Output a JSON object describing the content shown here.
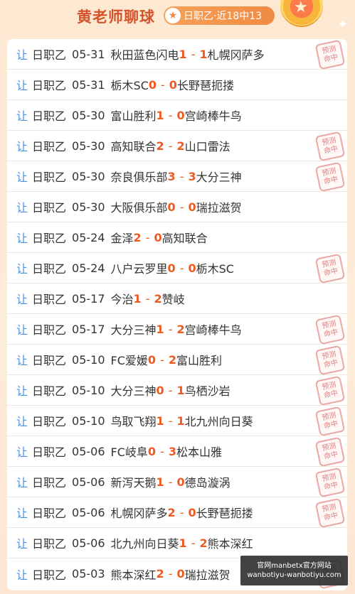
{
  "header": {
    "title": "黄老师聊球",
    "tag": "日职乙·近18中13",
    "tag_icon": "star-icon"
  },
  "stamp_text": [
    "预测",
    "命中"
  ],
  "matches": [
    {
      "rang": "让",
      "league": "日职乙",
      "date": "05-31",
      "home": "秋田蓝色闪电",
      "hs": "1",
      "as": "1",
      "away": "札幌冈萨多",
      "hit": true
    },
    {
      "rang": "让",
      "league": "日职乙",
      "date": "05-31",
      "home": "栃木SC",
      "hs": "0",
      "as": "0",
      "away": "长野琶扼搂",
      "hit": false
    },
    {
      "rang": "让",
      "league": "日职乙",
      "date": "05-30",
      "home": "富山胜利",
      "hs": "1",
      "as": "0",
      "away": "宫崎棒牛鸟",
      "hit": false
    },
    {
      "rang": "让",
      "league": "日职乙",
      "date": "05-30",
      "home": "高知联合",
      "hs": "2",
      "as": "2",
      "away": "山口雷法",
      "hit": true
    },
    {
      "rang": "让",
      "league": "日职乙",
      "date": "05-30",
      "home": "奈良俱乐部",
      "hs": "3",
      "as": "3",
      "away": "大分三神",
      "hit": true
    },
    {
      "rang": "让",
      "league": "日职乙",
      "date": "05-30",
      "home": "大阪俱乐部",
      "hs": "0",
      "as": "0",
      "away": "瑞拉滋贺",
      "hit": false
    },
    {
      "rang": "让",
      "league": "日职乙",
      "date": "05-24",
      "home": "金泽",
      "hs": "2",
      "as": "0",
      "away": "高知联合",
      "hit": false
    },
    {
      "rang": "让",
      "league": "日职乙",
      "date": "05-24",
      "home": "八户云罗里",
      "hs": "0",
      "as": "0",
      "away": "栃木SC",
      "hit": true
    },
    {
      "rang": "让",
      "league": "日职乙",
      "date": "05-17",
      "home": "今治",
      "hs": "1",
      "as": "2",
      "away": "赞岐",
      "hit": false
    },
    {
      "rang": "让",
      "league": "日职乙",
      "date": "05-17",
      "home": "大分三神",
      "hs": "1",
      "as": "2",
      "away": "宫崎棒牛鸟",
      "hit": true
    },
    {
      "rang": "让",
      "league": "日职乙",
      "date": "05-10",
      "home": "FC爱媛",
      "hs": "0",
      "as": "2",
      "away": "富山胜利",
      "hit": true
    },
    {
      "rang": "让",
      "league": "日职乙",
      "date": "05-10",
      "home": "大分三神",
      "hs": "0",
      "as": "1",
      "away": "鸟栖沙岩",
      "hit": true
    },
    {
      "rang": "让",
      "league": "日职乙",
      "date": "05-10",
      "home": "鸟取飞翔",
      "hs": "1",
      "as": "1",
      "away": "北九州向日葵",
      "hit": true
    },
    {
      "rang": "让",
      "league": "日职乙",
      "date": "05-06",
      "home": "FC岐阜",
      "hs": "0",
      "as": "3",
      "away": "松本山雅",
      "hit": true
    },
    {
      "rang": "让",
      "league": "日职乙",
      "date": "05-06",
      "home": "新泻天鹅",
      "hs": "1",
      "as": "0",
      "away": "德岛漩涡",
      "hit": true
    },
    {
      "rang": "让",
      "league": "日职乙",
      "date": "05-06",
      "home": "札幌冈萨多",
      "hs": "2",
      "as": "0",
      "away": "长野琶扼搂",
      "hit": true
    },
    {
      "rang": "让",
      "league": "日职乙",
      "date": "05-06",
      "home": "北九州向日葵",
      "hs": "1",
      "as": "2",
      "away": "熊本深红",
      "hit": false
    },
    {
      "rang": "让",
      "league": "日职乙",
      "date": "05-03",
      "home": "熊本深红",
      "hs": "2",
      "as": "0",
      "away": "瑞拉滋贺",
      "hit": true
    }
  ],
  "watermark": {
    "line1": "官网manbetx官方网站",
    "line2": "wanbotiyu-wanbotiyu.com"
  },
  "colors": {
    "accent": "#ee5a1f",
    "rang": "#4a8fe0",
    "title": "#d4532a",
    "stamp": "#e57f7c"
  }
}
